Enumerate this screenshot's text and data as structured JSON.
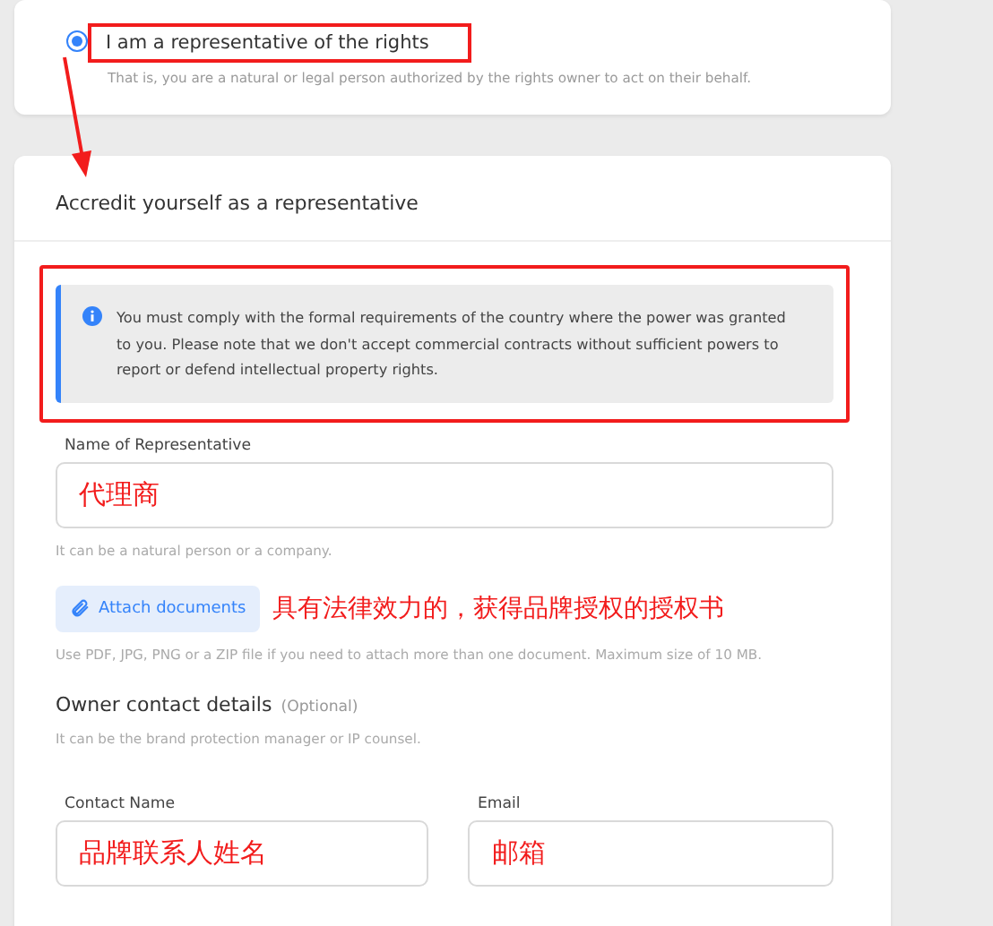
{
  "option": {
    "label": "I am a representative of the rights",
    "description": "That is, you are a natural or legal person authorized by the rights owner to act on their behalf.",
    "selected": true
  },
  "section": {
    "title": "Accredit yourself as a representative",
    "notice": "You must comply with the formal requirements of the country where the power was granted to you. Please note that we don't accept commercial contracts without sufficient powers to report or defend intellectual property rights.",
    "representative": {
      "label": "Name of Representative",
      "value": "代理商",
      "hint": "It can be a natural person or a company."
    },
    "attach": {
      "button": "Attach documents",
      "annotation": "具有法律效力的，获得品牌授权的授权书",
      "hint": "Use PDF, JPG, PNG or a ZIP file if you need to attach more than one document. Maximum size of 10 MB."
    },
    "owner": {
      "title": "Owner contact details",
      "optional": "(Optional)",
      "hint": "It can be the brand protection manager or IP counsel.",
      "fields": [
        {
          "label": "Contact Name",
          "value": "品牌联系人姓名"
        },
        {
          "label": "Email",
          "value": "邮箱"
        }
      ]
    }
  }
}
